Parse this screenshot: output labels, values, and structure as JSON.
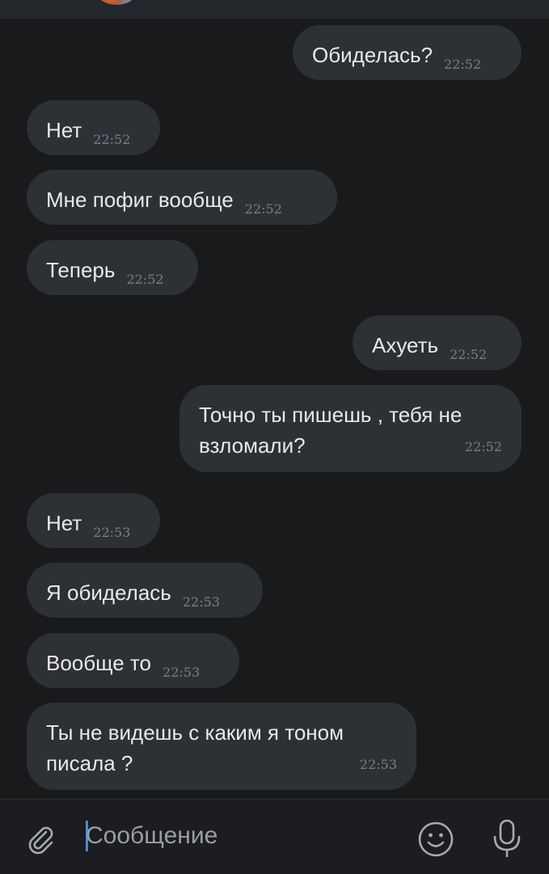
{
  "colors": {
    "background": "#191a1c",
    "bubble": "#2d3034",
    "text": "#e9e9e9",
    "time": "#7b7f85",
    "caret": "#4a8bd6",
    "icon": "#a7abb0"
  },
  "messages": [
    {
      "text": "Обиделась?",
      "time": "22:52",
      "direction": "outgoing"
    },
    {
      "text": "Нет",
      "time": "22:52",
      "direction": "incoming"
    },
    {
      "text": "Мне пофиг вообще",
      "time": "22:52",
      "direction": "incoming"
    },
    {
      "text": "Теперь",
      "time": "22:52",
      "direction": "incoming"
    },
    {
      "text": "Ахуеть",
      "time": "22:52",
      "direction": "outgoing"
    },
    {
      "text": "Точно ты пишешь , тебя не\nвзломали?",
      "time": "22:52",
      "direction": "outgoing"
    },
    {
      "text": "Нет",
      "time": "22:53",
      "direction": "incoming"
    },
    {
      "text": "Я обиделась",
      "time": "22:53",
      "direction": "incoming"
    },
    {
      "text": "Вообще то",
      "time": "22:53",
      "direction": "incoming"
    },
    {
      "text": "Ты не видешь с каким я тоном\nписала ?",
      "time": "22:53",
      "direction": "incoming"
    }
  ],
  "composer": {
    "placeholder": "Сообщение",
    "attach_icon": "paperclip-icon",
    "emoji_icon": "smiley-icon",
    "mic_icon": "microphone-icon"
  }
}
